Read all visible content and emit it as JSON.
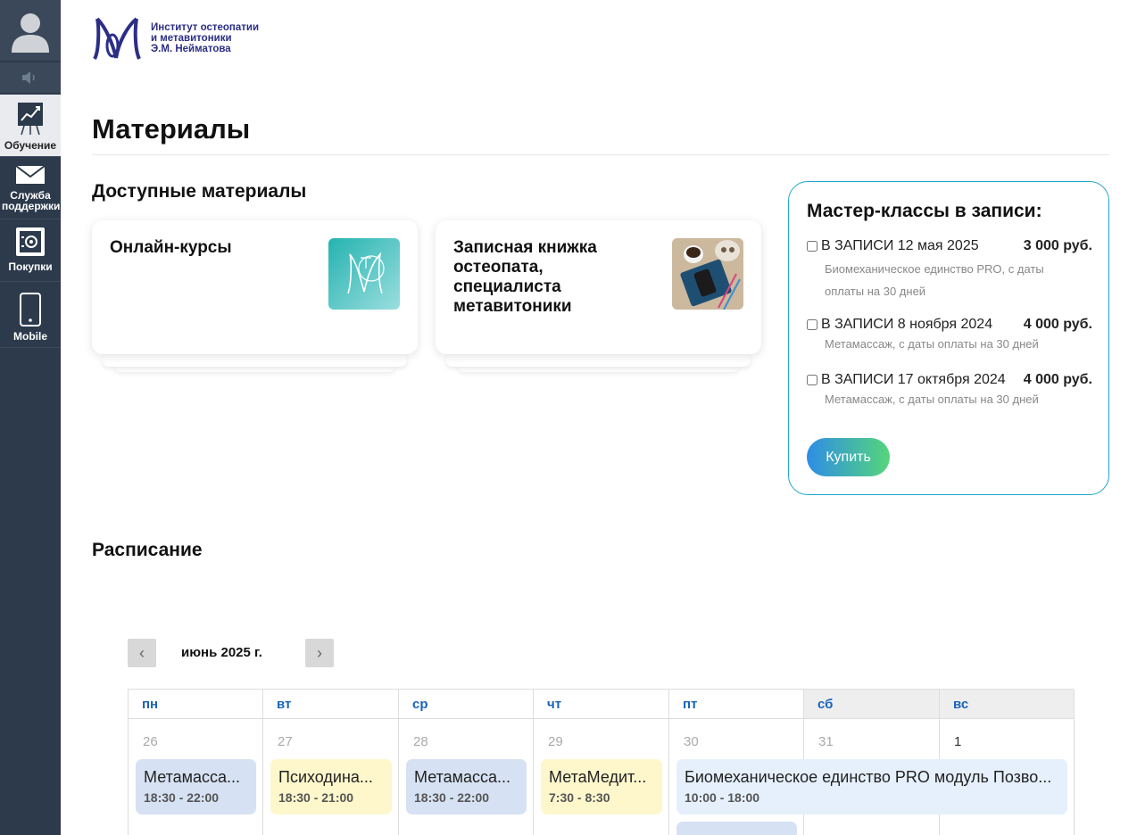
{
  "sidebar": {
    "items": [
      {
        "label": "Обучение",
        "icon": "chart-board-icon"
      },
      {
        "label": "Служба поддержки",
        "icon": "envelope-icon"
      },
      {
        "label": "Покупки",
        "icon": "safe-icon"
      },
      {
        "label": "Mobile",
        "icon": "mobile-phone-icon"
      }
    ]
  },
  "logo": {
    "line1": "Институт остеопатии",
    "line2": "и метавитоники",
    "line3": "Э.М. Нейматова"
  },
  "page": {
    "title": "Материалы",
    "available_title": "Доступные материалы",
    "schedule_title": "Расписание"
  },
  "cards": [
    {
      "title": "Онлайн-курсы"
    },
    {
      "title": "Записная книжка остеопата, специалиста метавитоники"
    }
  ],
  "masterclasses": {
    "title": "Мастер-классы в записи:",
    "items": [
      {
        "name": "В ЗАПИСИ 12 мая 2025",
        "price": "3 000 руб.",
        "desc": "Биомеханическое единство PRO, с даты оплаты на 30 дней",
        "checked": false
      },
      {
        "name": "В ЗАПИСИ 8 ноября 2024",
        "price": "4 000 руб.",
        "desc": "Метамассаж, с даты оплаты на 30 дней",
        "checked": false
      },
      {
        "name": "В ЗАПИСИ 17 октября 2024",
        "price": "4 000 руб.",
        "desc": "Метамассаж, с даты оплаты на 30 дней",
        "checked": false
      }
    ],
    "buy_label": "Купить"
  },
  "calendar": {
    "month": "июнь 2025 г.",
    "prev": "‹",
    "next": "›",
    "weekdays": [
      "пн",
      "вт",
      "ср",
      "чт",
      "пт",
      "сб",
      "вс"
    ],
    "days": [
      "26",
      "27",
      "28",
      "29",
      "30",
      "31",
      "1"
    ],
    "events": [
      {
        "title": "Метамасса...",
        "time": "18:30 - 22:00"
      },
      {
        "title": "Психодина...",
        "time": "18:30 - 21:00"
      },
      {
        "title": "Метамасса...",
        "time": "18:30 - 22:00"
      },
      {
        "title": "МетаМедит...",
        "time": "7:30 - 8:30"
      },
      {
        "title": "Биомеханическое единство PRO модуль Позво...",
        "time": "10:00 - 18:00"
      }
    ]
  },
  "colors": {
    "sidebar": "#2c3a4b",
    "accent": "#1fa6c9",
    "weekday": "#1a64b8",
    "brand": "#2c2e86"
  }
}
